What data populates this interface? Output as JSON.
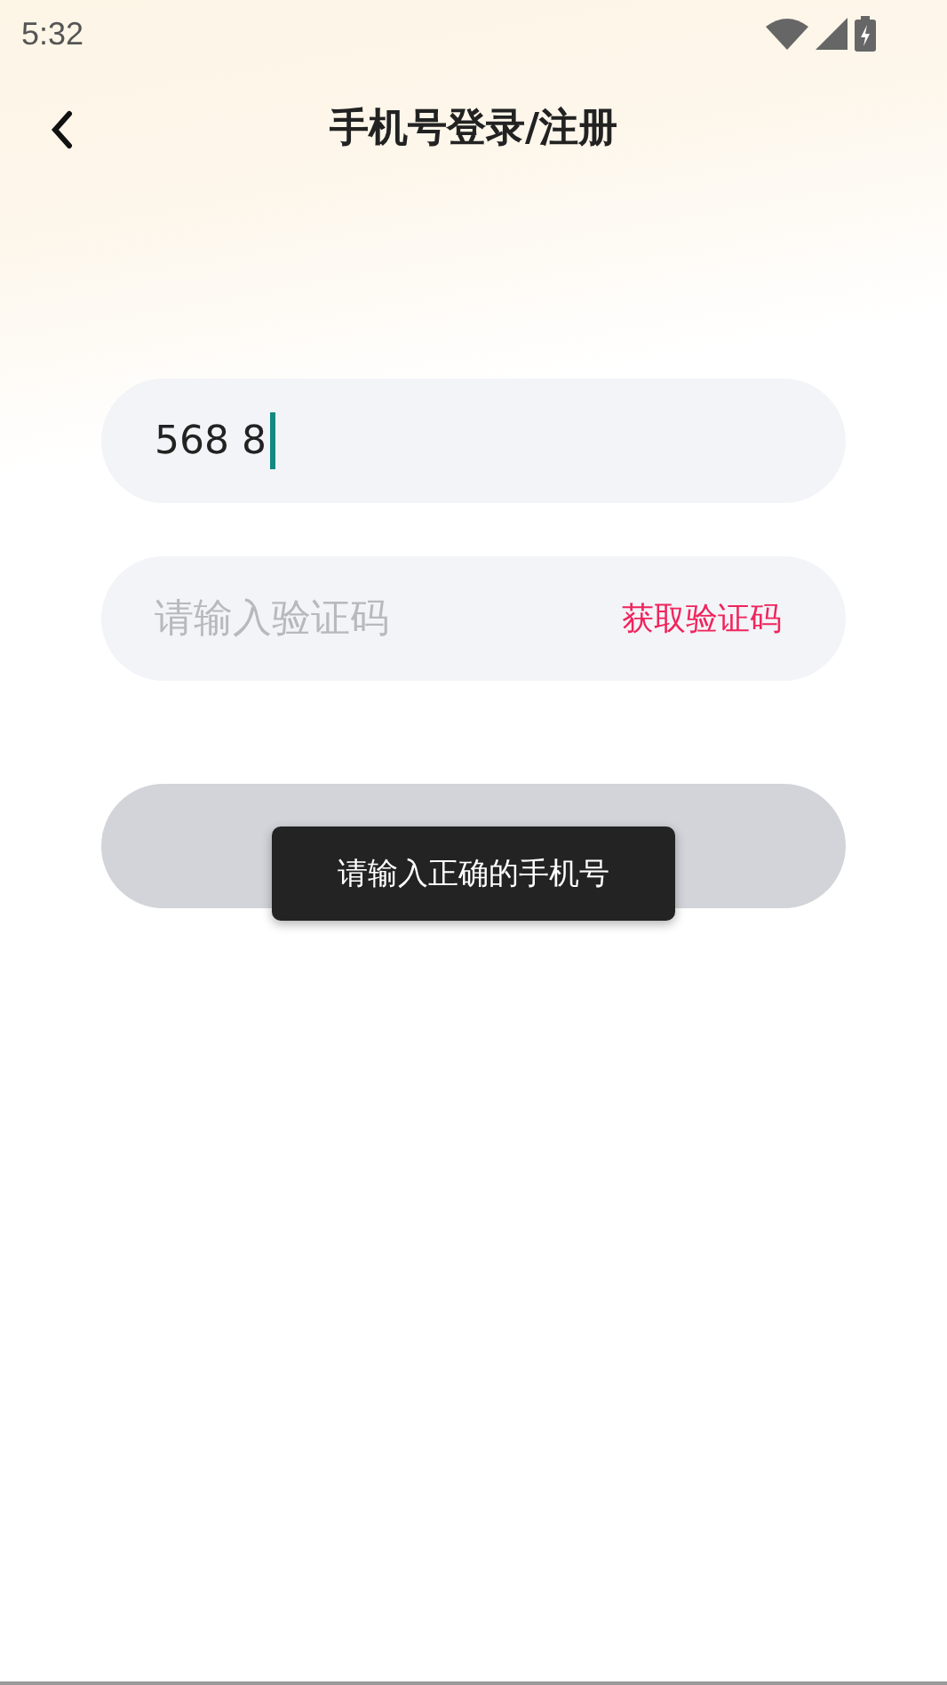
{
  "status_bar": {
    "time": "5:32"
  },
  "header": {
    "title": "手机号登录/注册"
  },
  "phone_field": {
    "value": "568 8",
    "focused": true
  },
  "code_field": {
    "placeholder": "请输入验证码",
    "get_code": "获取验证码"
  },
  "login_button": {
    "disabled": true
  },
  "toast": {
    "message": "请输入正确的手机号"
  }
}
